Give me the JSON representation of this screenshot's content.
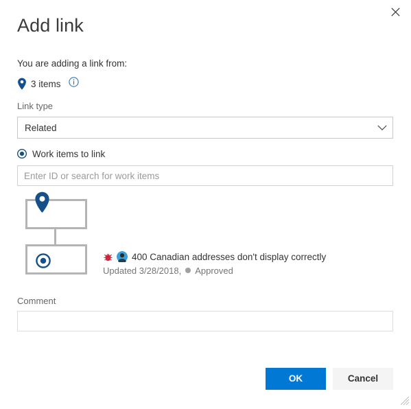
{
  "dialog": {
    "title": "Add link",
    "close_label": "Close",
    "close_icon": "close-icon",
    "resize_grip_icon": "resize-grip-icon"
  },
  "source": {
    "subtitle": "You are adding a link from:",
    "pin_icon": "location-pin-icon",
    "items_count_label": "3 items",
    "info_icon": "info-icon"
  },
  "link_type": {
    "label": "Link type",
    "selected": "Related",
    "chevron_icon": "chevron-down-icon",
    "options": [
      "Related"
    ]
  },
  "target": {
    "radio_label": "Work items to link",
    "radio_icon": "radio-selected-icon",
    "radio_checked": true,
    "search_placeholder": "Enter ID or search for work items",
    "search_value": ""
  },
  "tree": {
    "parent_node_icon": "location-pin-icon",
    "child_node_icon": "target-circle-icon"
  },
  "work_item": {
    "type_icon": "bug-icon",
    "avatar_icon": "avatar-icon",
    "title": "400 Canadian addresses don't display correctly",
    "updated_text": "Updated 3/28/2018,",
    "state_dot": "state-dot-icon",
    "state": "Approved"
  },
  "comment": {
    "label": "Comment",
    "value": "",
    "placeholder": ""
  },
  "footer": {
    "ok_label": "OK",
    "cancel_label": "Cancel"
  },
  "colors": {
    "accent": "#0078d4",
    "pin_blue": "#16508a",
    "border": "#c8c8c8",
    "tree_border": "#b4b4b4",
    "muted_text": "#767676",
    "bug_red": "#cc293d",
    "status_dot": "#a0a0a0"
  }
}
